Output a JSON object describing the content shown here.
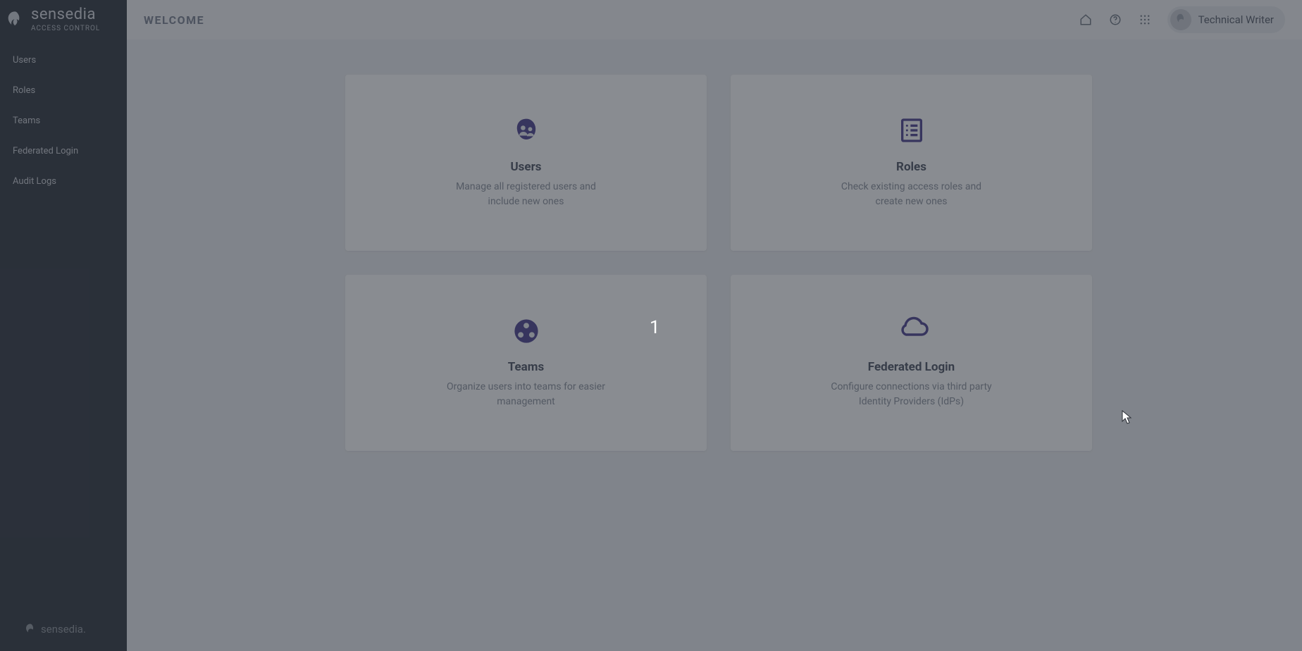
{
  "brand": {
    "name": "sensedia",
    "subtitle": "ACCESS CONTROL",
    "footer": "sensedia."
  },
  "sidebar": {
    "items": [
      {
        "label": "Users",
        "name": "sidebar-item-users"
      },
      {
        "label": "Roles",
        "name": "sidebar-item-roles"
      },
      {
        "label": "Teams",
        "name": "sidebar-item-teams"
      },
      {
        "label": "Federated Login",
        "name": "sidebar-item-federated-login"
      },
      {
        "label": "Audit Logs",
        "name": "sidebar-item-audit-logs"
      }
    ]
  },
  "header": {
    "title": "WELCOME",
    "user": "Technical Writer"
  },
  "cards": [
    {
      "title": "Users",
      "desc": "Manage all registered users and include new ones",
      "icon": "users-icon",
      "name": "card-users"
    },
    {
      "title": "Roles",
      "desc": "Check existing access roles and create new ones",
      "icon": "list-icon",
      "name": "card-roles"
    },
    {
      "title": "Teams",
      "desc": "Organize users into teams for easier management",
      "icon": "teams-icon",
      "name": "card-teams"
    },
    {
      "title": "Federated Login",
      "desc": "Configure connections via third party Identity Providers (IdPs)",
      "icon": "cloud-icon",
      "name": "card-federated-login"
    }
  ],
  "annotation": {
    "label": "1"
  }
}
